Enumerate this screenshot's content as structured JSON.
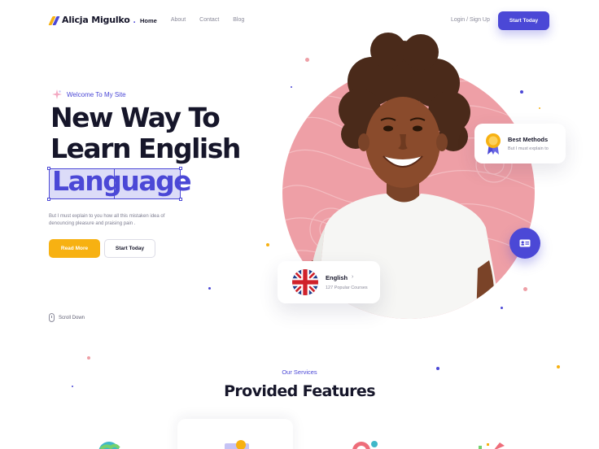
{
  "header": {
    "brand": "Alicja Migulko",
    "brand_dot": ".",
    "nav": [
      {
        "label": "Home",
        "active": true
      },
      {
        "label": "About",
        "active": false
      },
      {
        "label": "Contact",
        "active": false
      },
      {
        "label": "Blog",
        "active": false
      }
    ],
    "auth_label": "Login / Sign Up",
    "cta_label": "Start Today"
  },
  "hero": {
    "welcome": "Welcome To My Site",
    "title_line1": "New Way To",
    "title_line2": "Learn English",
    "title_line3": "Language",
    "description": "But I must explain to you how all this mistaken idea of denouncing pleasure and praising pain .",
    "read_more_label": "Read More",
    "start_today_label": "Start Today",
    "scroll_label": "Scroll Down"
  },
  "cards": {
    "methods": {
      "title": "Best Methods",
      "subtitle": "But I must explain to"
    },
    "english": {
      "title": "English",
      "chevron": "›",
      "subtitle": "127  Popular Courses"
    }
  },
  "services": {
    "label": "Our Services",
    "title": "Provided Features"
  },
  "colors": {
    "accent": "#4b48d6",
    "yellow": "#f7b112",
    "pink": "#ee9fa6",
    "dark": "#16162a"
  },
  "icons": [
    "sparkle-icon",
    "medal-icon",
    "id-card-icon",
    "uk-flag-icon",
    "mouse-icon"
  ]
}
